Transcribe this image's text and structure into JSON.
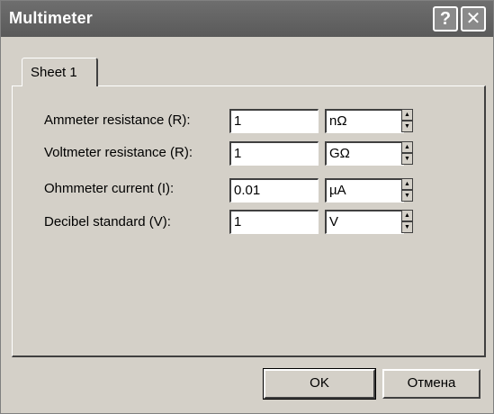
{
  "window": {
    "title": "Multimeter",
    "help_glyph": "?",
    "close_glyph": "✕"
  },
  "tabs": [
    {
      "label": "Sheet 1"
    }
  ],
  "rows": [
    {
      "label": "Ammeter resistance (R):",
      "value": "1",
      "unit": "nΩ"
    },
    {
      "label": "Voltmeter resistance (R):",
      "value": "1",
      "unit": "GΩ"
    },
    {
      "label": "Ohmmeter current (I):",
      "value": "0.01",
      "unit": "µA"
    },
    {
      "label": "Decibel standard (V):",
      "value": "1",
      "unit": "V"
    }
  ],
  "buttons": {
    "ok": "OK",
    "cancel": "Отмена"
  }
}
